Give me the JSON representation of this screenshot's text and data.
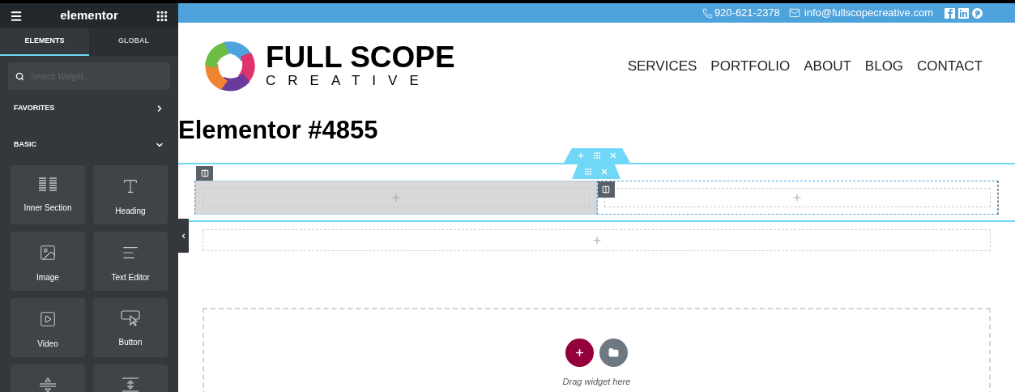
{
  "sidebar": {
    "logo": "elementor",
    "tabs": [
      {
        "label": "ELEMENTS",
        "selected": true
      },
      {
        "label": "GLOBAL",
        "selected": false
      }
    ],
    "search": {
      "placeholder": "Search Widget..."
    },
    "categories": [
      {
        "label": "FAVORITES",
        "expanded": false
      },
      {
        "label": "BASIC",
        "expanded": true
      }
    ],
    "widgets": [
      {
        "kind": "inner-section",
        "label": "Inner Section"
      },
      {
        "kind": "heading",
        "label": "Heading"
      },
      {
        "kind": "image",
        "label": "Image"
      },
      {
        "kind": "text-editor",
        "label": "Text Editor"
      },
      {
        "kind": "video",
        "label": "Video"
      },
      {
        "kind": "button",
        "label": "Button"
      },
      {
        "kind": "divider"
      },
      {
        "kind": "spacer"
      }
    ]
  },
  "topbar": {
    "phone": "920-621-2378",
    "email": "info@fullscopecreative.com"
  },
  "site": {
    "logo_title": "FULL SCOPE",
    "logo_subtitle": "CREATIVE",
    "nav": [
      "SERVICES",
      "PORTFOLIO",
      "ABOUT",
      "BLOG",
      "CONTACT"
    ]
  },
  "page_title": "Elementor #4855",
  "columns": [
    {
      "selected": true
    },
    {
      "selected": false
    }
  ],
  "dropzone": {
    "hint": "Drag widget here"
  }
}
